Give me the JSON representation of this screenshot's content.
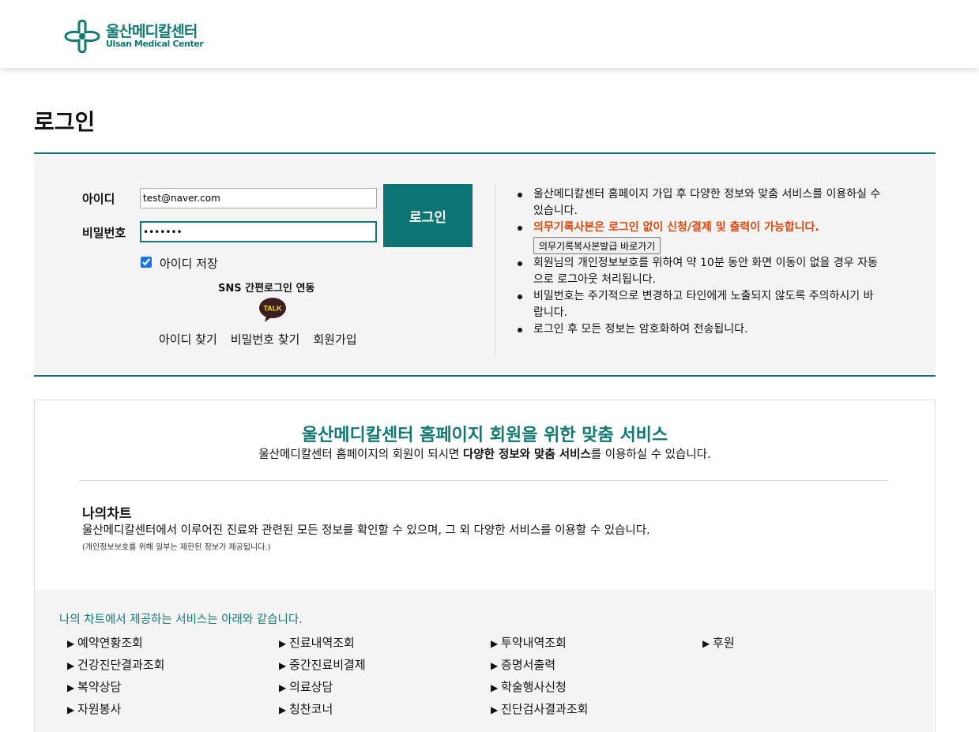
{
  "header": {
    "logo_ko": "울산메디칼센터",
    "logo_en": "Ulsan Medical Center"
  },
  "page_title": "로그인",
  "login": {
    "id_label": "아이디",
    "id_value": "test@naver.com",
    "pw_label": "비밀번호",
    "pw_value": "•••••••",
    "login_button": "로그인",
    "remember_label": "아이디 저장",
    "remember_checked": true,
    "sns_title": "SNS 간편로그인 연동",
    "kakao_icon_label": "TALK",
    "links": [
      "아이디 찾기",
      "비밀번호 찾기",
      "회원가입"
    ]
  },
  "notes": [
    "울산메디칼센터 홈페이지 가입 후 다양한 정보와 맞춤 서비스를 이용하실 수 있습니다.",
    "의무기록사본은 로그인 없이 신청/결제 및 출력이 가능합니다.",
    "회원님의 개인정보보호를 위하여 약 10분 동안 화면 이동이 없을 경우 자동으로 로그아웃 처리됩니다.",
    "비밀번호는 주기적으로 변경하고 타인에게 노출되지 않도록 주의하시기 바랍니다.",
    "로그인 후 모든 정보는 암호화하여 전송됩니다."
  ],
  "record_button": "의무기록복사본발급 바로가기",
  "service": {
    "title": "울산메디칼센터 홈페이지 회원을 위한 맞춤 서비스",
    "sub_before": "울산메디칼센터 홈페이지의 회원이 되시면 ",
    "sub_bold": "다양한 정보와 맞춤 서비스",
    "sub_after": "를 이용하실 수 있습니다.",
    "chart_title": "나의차트",
    "chart_desc": "울산메디칼센터에서 이루어진 진료와 관련된 모든 정보를 확인할 수 있으며, 그 외 다양한 서비스를 이용할 수 있습니다.",
    "chart_note": "(개인정보보호를 위해 일부는 제한된 정보가 제공됩니다.)",
    "panel_title": "나의 차트에서 제공하는 서비스는 아래와 같습니다.",
    "items": [
      "예약연황조회",
      "진료내역조회",
      "투약내역조회",
      "후원",
      "건강진단결과조회",
      "중간진료비결제",
      "증명서출력",
      "",
      "복약상담",
      "의료상담",
      "학술행사신청",
      "",
      "자원봉사",
      "칭찬코너",
      "진단검사결과조회",
      ""
    ]
  },
  "colors": {
    "brand": "#127872",
    "login_button": "#0c7574",
    "alert": "#dc4a11"
  }
}
